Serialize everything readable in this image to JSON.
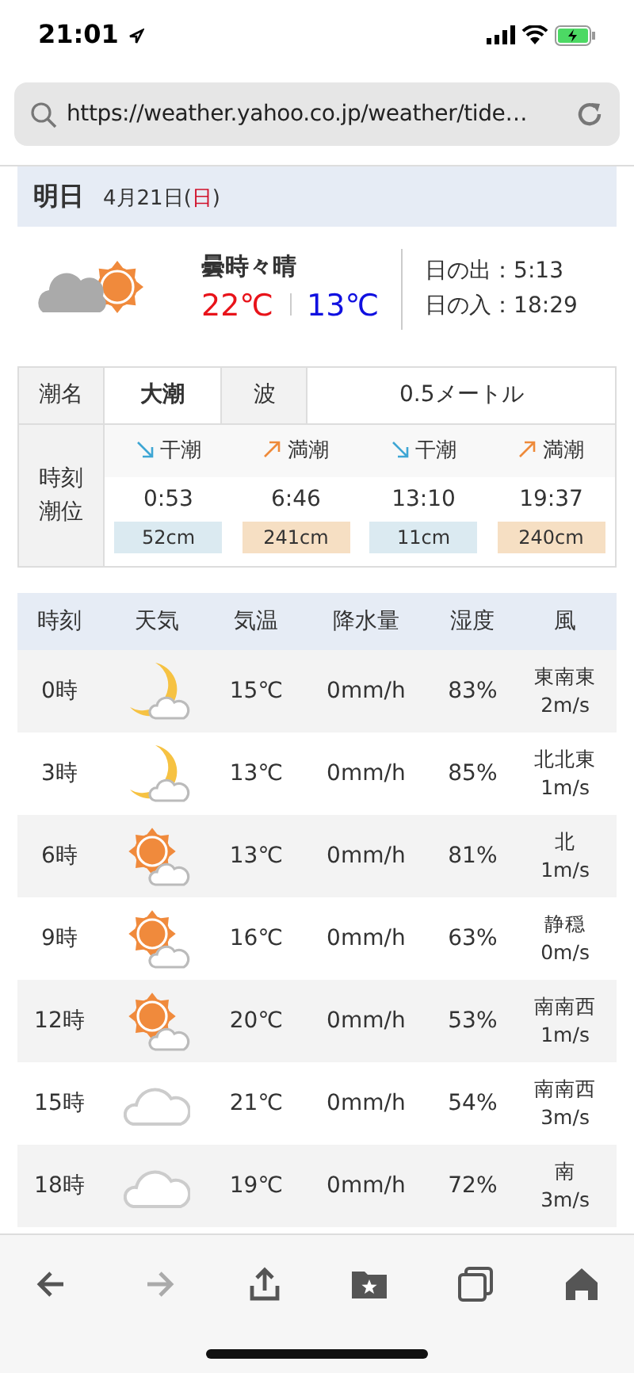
{
  "status_bar": {
    "time": "21:01"
  },
  "address_bar": {
    "url": "https://weather.yahoo.co.jp/weather/tide…"
  },
  "day_header": {
    "label": "明日",
    "date_parts": [
      {
        "text": "4月21日(",
        "holiday": false
      },
      {
        "text": "日",
        "holiday": true
      },
      {
        "text": ")",
        "holiday": false
      }
    ]
  },
  "forecast": {
    "kind": "cloud-sun",
    "condition": "曇時々晴",
    "high": "22℃",
    "low": "13℃",
    "sunrise": "日の出：5:13",
    "sunset": "日の入：18:29"
  },
  "tide_table": {
    "name_label": "潮名",
    "name": "大潮",
    "wave_label": "波",
    "wave": "0.5メートル",
    "times_label_lines": [
      "時刻",
      "潮位"
    ],
    "tides": [
      {
        "kind": "low",
        "label": "干潮",
        "time": "0:53",
        "level_text": "52cm"
      },
      {
        "kind": "high",
        "label": "満潮",
        "time": "6:46",
        "level_text": "241cm"
      },
      {
        "kind": "low",
        "label": "干潮",
        "time": "13:10",
        "level_text": "11cm"
      },
      {
        "kind": "high",
        "label": "満潮",
        "time": "19:37",
        "level_text": "240cm"
      }
    ]
  },
  "hourly_table": {
    "columns": [
      "時刻",
      "天気",
      "気温",
      "降水量",
      "湿度",
      "風"
    ],
    "rows": [
      {
        "time": "0時",
        "kind": "moon-cloud",
        "temp": "15℃",
        "precip": "0mm/h",
        "humidity": "83%",
        "wind_dir": "東南東",
        "wind_speed": "2m/s"
      },
      {
        "time": "3時",
        "kind": "moon-cloud",
        "temp": "13℃",
        "precip": "0mm/h",
        "humidity": "85%",
        "wind_dir": "北北東",
        "wind_speed": "1m/s"
      },
      {
        "time": "6時",
        "kind": "sun-cloud",
        "temp": "13℃",
        "precip": "0mm/h",
        "humidity": "81%",
        "wind_dir": "北",
        "wind_speed": "1m/s"
      },
      {
        "time": "9時",
        "kind": "sun-cloud",
        "temp": "16℃",
        "precip": "0mm/h",
        "humidity": "63%",
        "wind_dir": "静穏",
        "wind_speed": "0m/s"
      },
      {
        "time": "12時",
        "kind": "sun-cloud",
        "temp": "20℃",
        "precip": "0mm/h",
        "humidity": "53%",
        "wind_dir": "南南西",
        "wind_speed": "1m/s"
      },
      {
        "time": "15時",
        "kind": "cloud",
        "temp": "21℃",
        "precip": "0mm/h",
        "humidity": "54%",
        "wind_dir": "南南西",
        "wind_speed": "3m/s"
      },
      {
        "time": "18時",
        "kind": "cloud",
        "temp": "19℃",
        "precip": "0mm/h",
        "humidity": "72%",
        "wind_dir": "南",
        "wind_speed": "3m/s"
      }
    ]
  },
  "toolbar": {
    "buttons": [
      {
        "kind": "back",
        "disabled": false
      },
      {
        "kind": "forward",
        "disabled": true
      },
      {
        "kind": "share",
        "disabled": false
      },
      {
        "kind": "bookmarks",
        "disabled": false
      },
      {
        "kind": "tabs",
        "disabled": false
      },
      {
        "kind": "home",
        "disabled": false
      }
    ]
  }
}
